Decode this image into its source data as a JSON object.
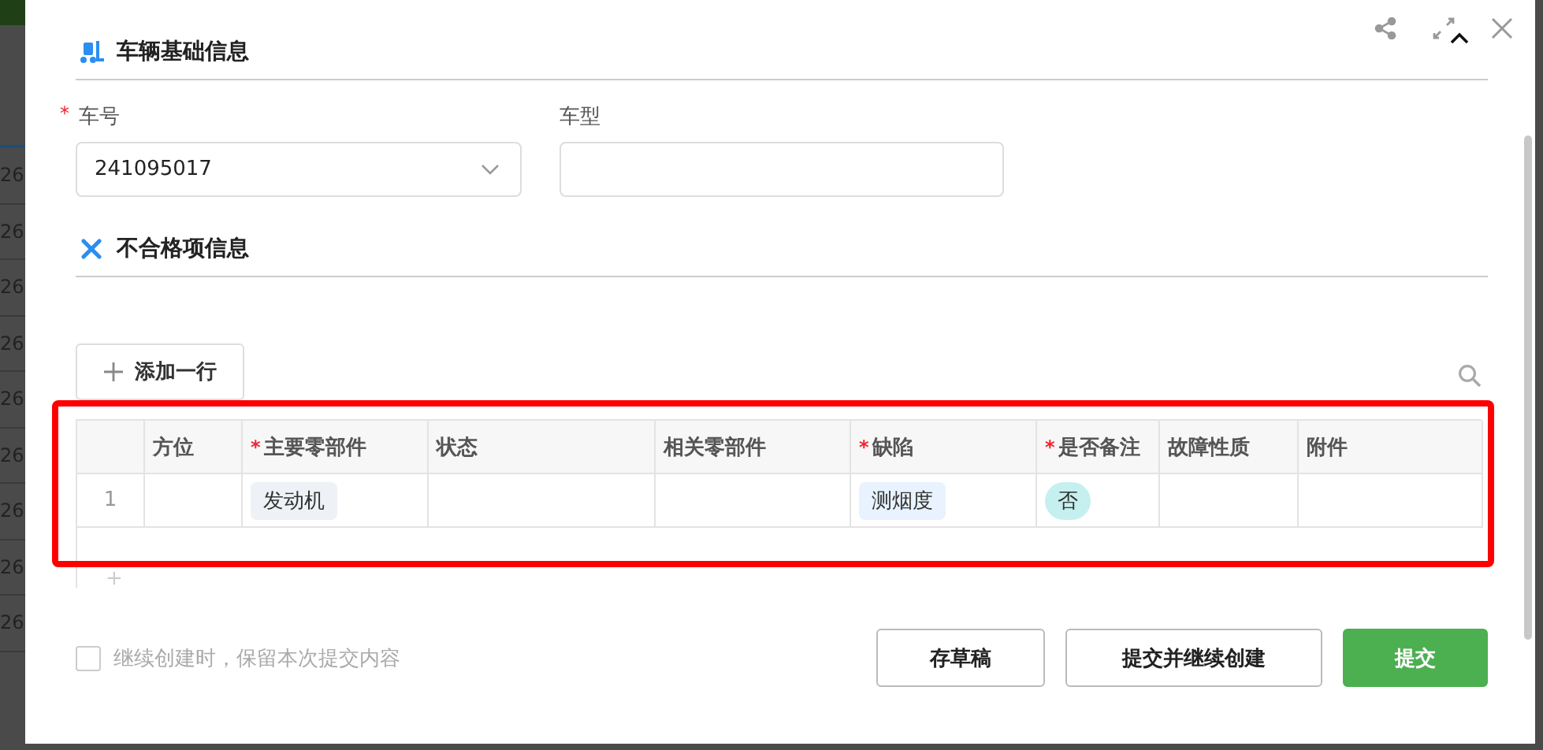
{
  "backdrop": {
    "rows": [
      "26",
      "26",
      "26",
      "26",
      "26",
      "26",
      "26",
      "26",
      "26"
    ]
  },
  "dialog": {
    "sections": [
      {
        "kind": "vehicle",
        "title": "车辆基础信息",
        "expanded": true
      },
      {
        "kind": "defects",
        "title": "不合格项信息"
      }
    ],
    "fields": [
      {
        "label": "车号",
        "required_mark": "*",
        "kind": "select",
        "value": "241095017"
      },
      {
        "label": "车型",
        "kind": "text"
      }
    ],
    "add_row_button": "添加一行",
    "table": {
      "columns": [
        {
          "label": "方位"
        },
        {
          "label": "主要零部件",
          "required_mark": "*"
        },
        {
          "label": "状态"
        },
        {
          "label": "相关零部件"
        },
        {
          "label": "缺陷",
          "required_mark": "*"
        },
        {
          "label": "是否备注",
          "required_mark": "*"
        },
        {
          "label": "故障性质"
        },
        {
          "label": "附件"
        }
      ],
      "rows": [
        {
          "number": "1",
          "cells": [
            {
              "kind": "empty"
            },
            {
              "text": "发动机",
              "kind": "tag",
              "color": "#eef1f5"
            },
            {
              "kind": "empty"
            },
            {
              "kind": "empty"
            },
            {
              "text": "测烟度",
              "kind": "tag",
              "color": "#e8f3ff"
            },
            {
              "text": "否",
              "kind": "pill",
              "color": "#c6f0ef"
            },
            {
              "kind": "empty"
            },
            {
              "kind": "empty"
            }
          ]
        }
      ],
      "add_row_mark": "+"
    },
    "keep_content": {
      "label": "继续创建时，保留本次提交内容",
      "checked": false
    },
    "buttons": [
      {
        "label": "存草稿",
        "kind": "default"
      },
      {
        "label": "提交并继续创建",
        "kind": "default"
      },
      {
        "label": "提交",
        "kind": "primary"
      }
    ]
  }
}
